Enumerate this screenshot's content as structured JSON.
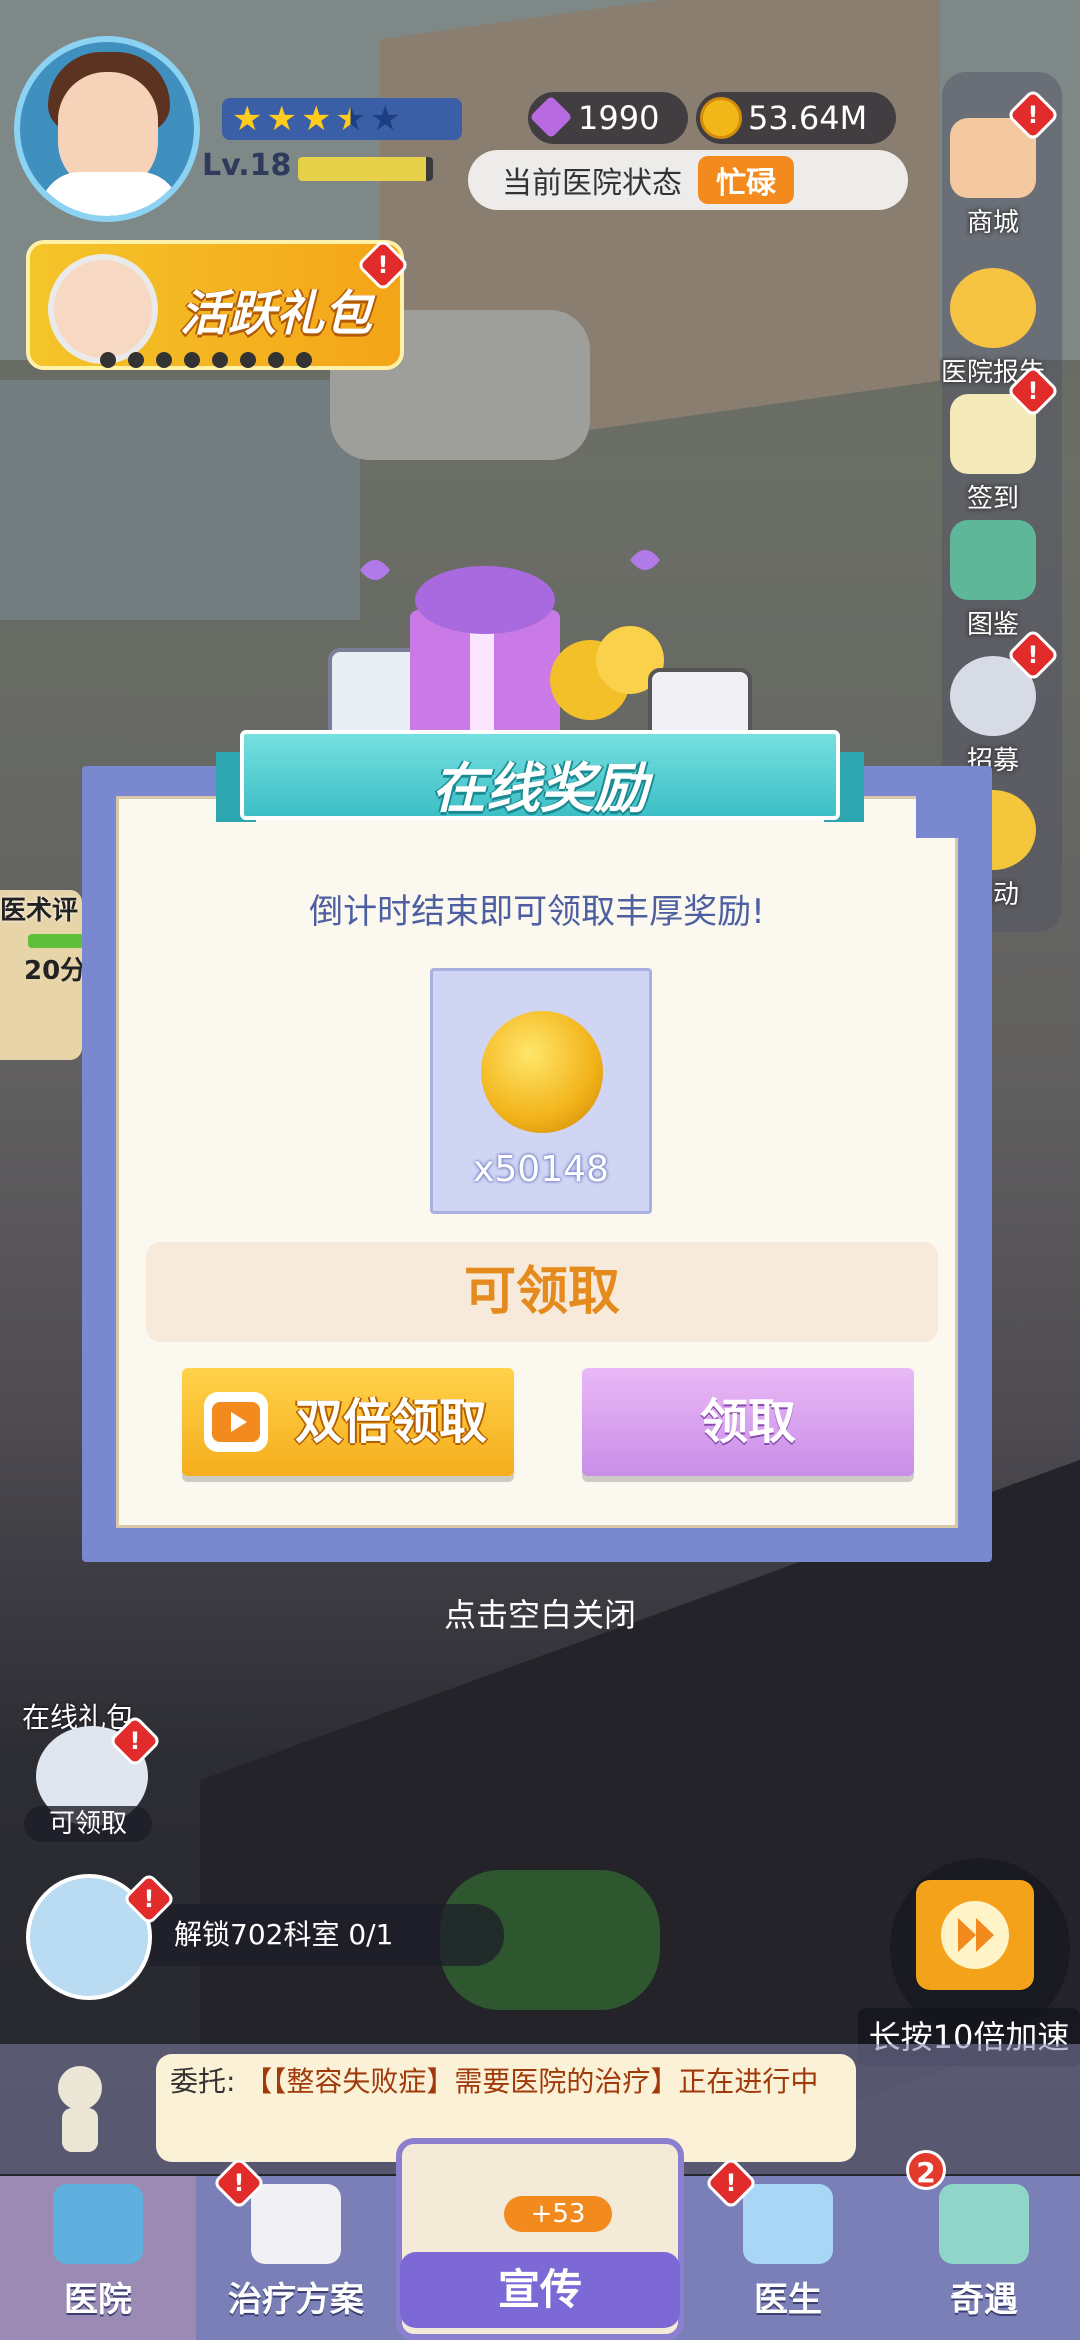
{
  "hud": {
    "stars_filled": 3.5,
    "stars_total": 5,
    "level": "Lv.18",
    "level_progress": 0.95,
    "gems": "1990",
    "coins": "53.64M",
    "status_label": "当前医院状态",
    "status_value": "忙碌"
  },
  "active_pack": {
    "label": "活跃礼包"
  },
  "side_menu": [
    {
      "label": "商城",
      "icon": "shop-icon"
    },
    {
      "label": "医院报告",
      "icon": "report-icon"
    },
    {
      "label": "签到",
      "icon": "checkin-icon"
    },
    {
      "label": "图鉴",
      "icon": "cards-icon"
    },
    {
      "label": "招募",
      "icon": "recruit-icon"
    },
    {
      "label": "活动",
      "icon": "event-icon"
    }
  ],
  "left_panel": {
    "medical_eval": "医术评",
    "points": "20分"
  },
  "dialog": {
    "title": "在线奖励",
    "subtitle": "倒计时结束即可领取丰厚奖励!",
    "reward_amount": "x50148",
    "claimable_label": "可领取",
    "double_button": "双倍领取",
    "claim_button": "领取"
  },
  "close_tip": "点击空白关闭",
  "online_gift": {
    "label": "在线礼包",
    "status": "可领取"
  },
  "quest": {
    "text": "解锁702科室  0/1"
  },
  "speed": {
    "label": "长按10倍加速"
  },
  "commission": {
    "lead": "委托: ",
    "text": "【【整容失败症】需要医院的治疗】正在进行中"
  },
  "promo": {
    "label": "宣传",
    "bonus": "+53"
  },
  "bottom_nav": [
    {
      "label": "医院"
    },
    {
      "label": "治疗方案"
    },
    {
      "label": "医生"
    },
    {
      "label": "奇遇",
      "badge": "2"
    }
  ],
  "colors": {
    "dialog_frame": "#7a88d0",
    "ribbon": "#3dbfc6",
    "claimable_text": "#e58b1e",
    "double_button": "#f5ad1c",
    "claim_button": "#c98de8"
  }
}
